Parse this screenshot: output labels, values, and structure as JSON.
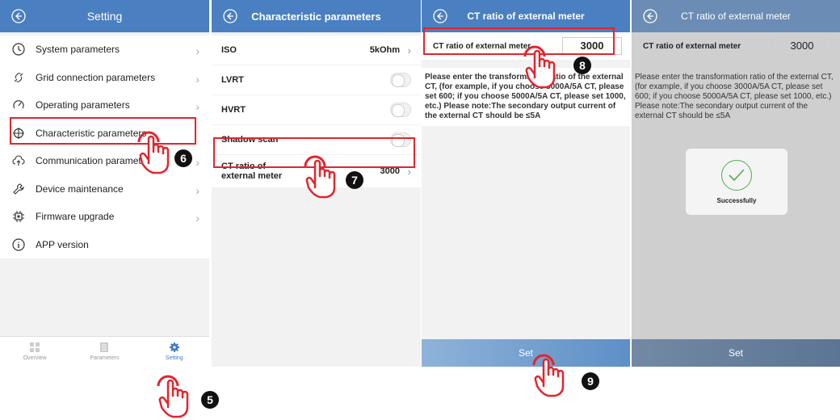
{
  "panel1": {
    "title": "Setting",
    "items": [
      {
        "label": "System parameters",
        "icon": "clock-icon",
        "chevron": true
      },
      {
        "label": "Grid connection parameters",
        "icon": "link-icon",
        "chevron": true
      },
      {
        "label": "Operating parameters",
        "icon": "gauge-icon",
        "chevron": true
      },
      {
        "label": "Characteristic parameters",
        "icon": "crosshair-icon",
        "chevron": false
      },
      {
        "label": "Communication parameters",
        "icon": "cloud-upload-icon",
        "chevron": true
      },
      {
        "label": "Device maintenance",
        "icon": "wrench-icon",
        "chevron": true
      },
      {
        "label": "Firmware upgrade",
        "icon": "chip-icon",
        "chevron": true
      },
      {
        "label": "APP version",
        "icon": "info-icon",
        "chevron": false
      }
    ],
    "tabs": [
      {
        "label": "Overview",
        "icon": "grid-icon"
      },
      {
        "label": "Parameters",
        "icon": "document-icon"
      },
      {
        "label": "Setting",
        "icon": "gear-icon"
      }
    ]
  },
  "panel2": {
    "title": "Characteristic parameters",
    "iso_label": "ISO",
    "iso_value": "5kOhm",
    "lvrt_label": "LVRT",
    "hvrt_label": "HVRT",
    "shadow_label": "Shadow scan",
    "ct_label_line1": "CT ratio of",
    "ct_label_line2": "external meter",
    "ct_value": "3000"
  },
  "panel3": {
    "title": "CT ratio of external meter",
    "field_label": "CT ratio of external meter",
    "field_value": "3000",
    "description": "Please enter the transformation ratio of the external CT, (for example, if you choose 3000A/5A CT, please set 600; if you choose 5000A/5A CT, please set 1000, etc.) Please note:The secondary output current of the external CT should be ≤5A",
    "set_label": "Set"
  },
  "panel4": {
    "title": "CT ratio of external meter",
    "field_label": "CT ratio of external meter",
    "field_value": "3000",
    "description": "Please enter the transformation ratio of the external CT, (for example, if you choose 3000A/5A CT, please set 600; if you choose 5000A/5A CT, please set 1000, etc.) Please note:The secondary output current of the external CT should be ≤5A",
    "dialog_message": "Successfully",
    "set_label": "Set"
  },
  "steps": [
    "5",
    "6",
    "7",
    "8",
    "9"
  ],
  "colors": {
    "header": "#4a7fc1",
    "highlight": "#e0262e",
    "accent": "#3e7ccd"
  }
}
